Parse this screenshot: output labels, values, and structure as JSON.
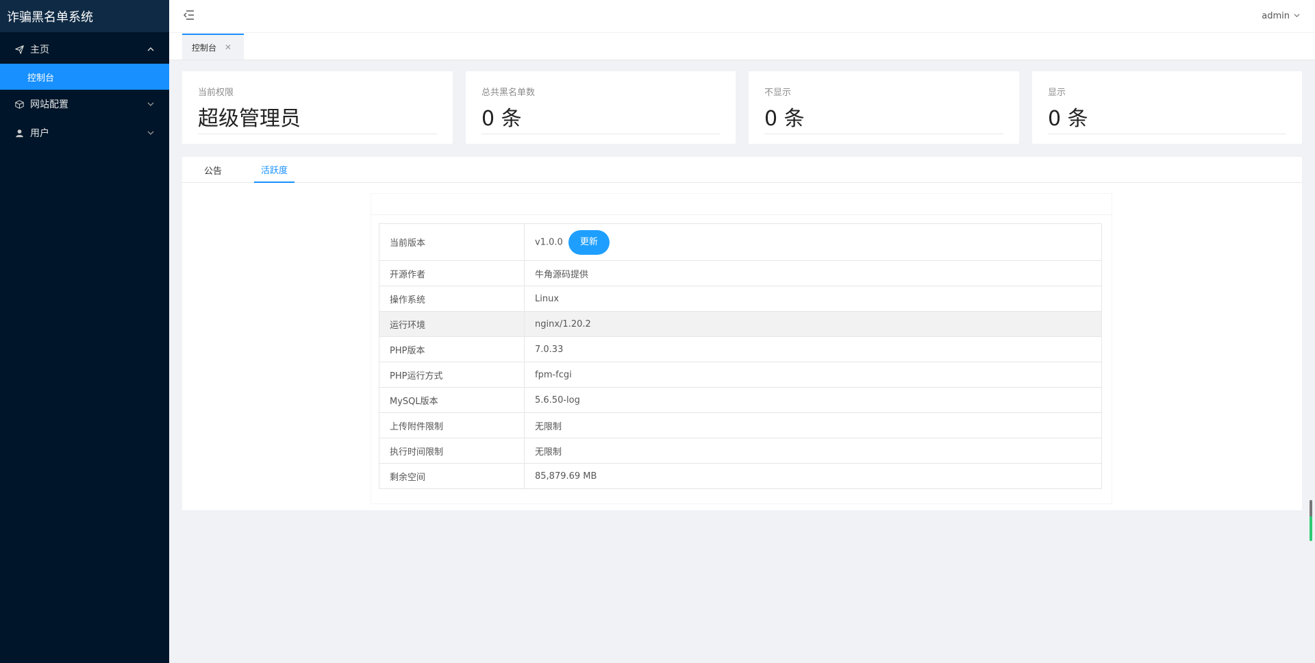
{
  "app": {
    "title": "诈骗黑名单系统"
  },
  "sidebar": {
    "items": [
      {
        "label": "主页",
        "icon": "paper-plane-icon",
        "expanded": true,
        "children": [
          {
            "label": "控制台",
            "active": true
          }
        ]
      },
      {
        "label": "网站配置",
        "icon": "cube-icon",
        "expanded": false
      },
      {
        "label": "用户",
        "icon": "user-icon",
        "expanded": false
      }
    ]
  },
  "header": {
    "user": "admin"
  },
  "tabs": [
    {
      "label": "控制台",
      "close": "✕"
    }
  ],
  "stats": [
    {
      "label": "当前权限",
      "value": "超级管理员"
    },
    {
      "label": "总共黑名单数",
      "value": "0 条"
    },
    {
      "label": "不显示",
      "value": "0 条"
    },
    {
      "label": "显示",
      "value": "0 条"
    }
  ],
  "panel": {
    "tabs": [
      {
        "label": "公告",
        "active": false
      },
      {
        "label": "活跃度",
        "active": true
      }
    ],
    "rows": [
      {
        "key": "当前版本",
        "value": "v1.0.0",
        "button": "更新"
      },
      {
        "key": "开源作者",
        "value": "牛角源码提供"
      },
      {
        "key": "操作系统",
        "value": "Linux"
      },
      {
        "key": "运行环境",
        "value": "nginx/1.20.2"
      },
      {
        "key": "PHP版本",
        "value": "7.0.33"
      },
      {
        "key": "PHP运行方式",
        "value": "fpm-fcgi"
      },
      {
        "key": "MySQL版本",
        "value": "5.6.50-log"
      },
      {
        "key": "上传附件限制",
        "value": "无限制"
      },
      {
        "key": "执行时间限制",
        "value": "无限制"
      },
      {
        "key": "剩余空间",
        "value": "85,879.69 MB"
      }
    ]
  },
  "colors": {
    "sidebar_bg": "#001529",
    "accent": "#1890ff",
    "button": "#1e9fff"
  }
}
